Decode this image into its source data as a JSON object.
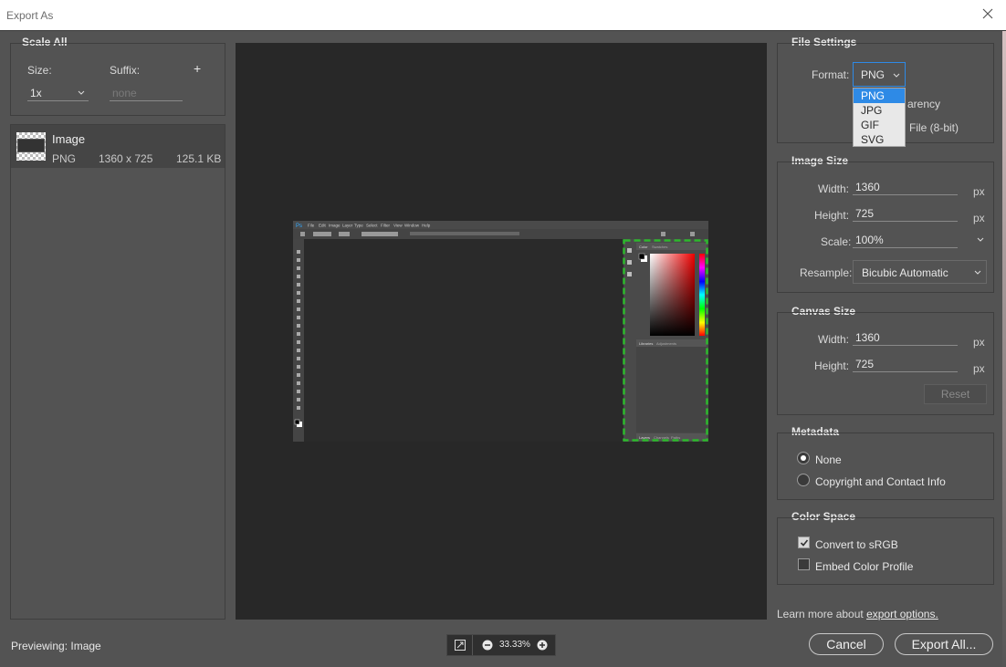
{
  "window": {
    "title": "Export As"
  },
  "scale_all": {
    "title": "Scale All",
    "size_label": "Size:",
    "size_value": "1x",
    "suffix_label": "Suffix:",
    "suffix_placeholder": "none",
    "add_label": "+"
  },
  "asset": {
    "name": "Image",
    "format": "PNG",
    "dimensions": "1360 x 725",
    "filesize": "125.1 KB"
  },
  "file_settings": {
    "title": "File Settings",
    "format_label": "Format:",
    "format_value": "PNG",
    "transparency_partial": "arency",
    "smaller_file_partial": "File (8-bit)",
    "format_options": [
      "PNG",
      "JPG",
      "GIF",
      "SVG"
    ]
  },
  "image_size": {
    "title": "Image Size",
    "width_label": "Width:",
    "width_value": "1360",
    "height_label": "Height:",
    "height_value": "725",
    "scale_label": "Scale:",
    "scale_value": "100%",
    "resample_label": "Resample:",
    "resample_value": "Bicubic Automatic",
    "unit": "px"
  },
  "canvas_size": {
    "title": "Canvas Size",
    "width_label": "Width:",
    "width_value": "1360",
    "height_label": "Height:",
    "height_value": "725",
    "unit": "px",
    "reset_label": "Reset"
  },
  "metadata": {
    "title": "Metadata",
    "option_none": "None",
    "option_copyright": "Copyright and Contact Info",
    "selected": "None"
  },
  "color_space": {
    "title": "Color Space",
    "convert_label": "Convert to sRGB",
    "convert_checked": true,
    "embed_label": "Embed Color Profile",
    "embed_checked": false
  },
  "footer": {
    "learn_more_prefix": "Learn more about ",
    "learn_more_link": "export options.",
    "previewing": "Previewing: Image",
    "zoom_level": "33.33%",
    "cancel_label": "Cancel",
    "export_label": "Export All..."
  },
  "mini_ps": {
    "logo": "Ps",
    "menu": [
      "File",
      "Edit",
      "Image",
      "Layer",
      "Type",
      "Select",
      "Filter",
      "View",
      "Window",
      "Help"
    ],
    "panel_tabs": [
      "Color",
      "Swatches"
    ],
    "panel_tabs2": [
      "Libraries",
      "Adjustments"
    ],
    "panel_tabs3": [
      "Layers",
      "Channels",
      "Paths"
    ]
  },
  "colors": {
    "accent": "#2e8ae6",
    "dialog_bg": "#535353",
    "preview_bg": "#282828",
    "selection_dashes": "#2db82d"
  }
}
